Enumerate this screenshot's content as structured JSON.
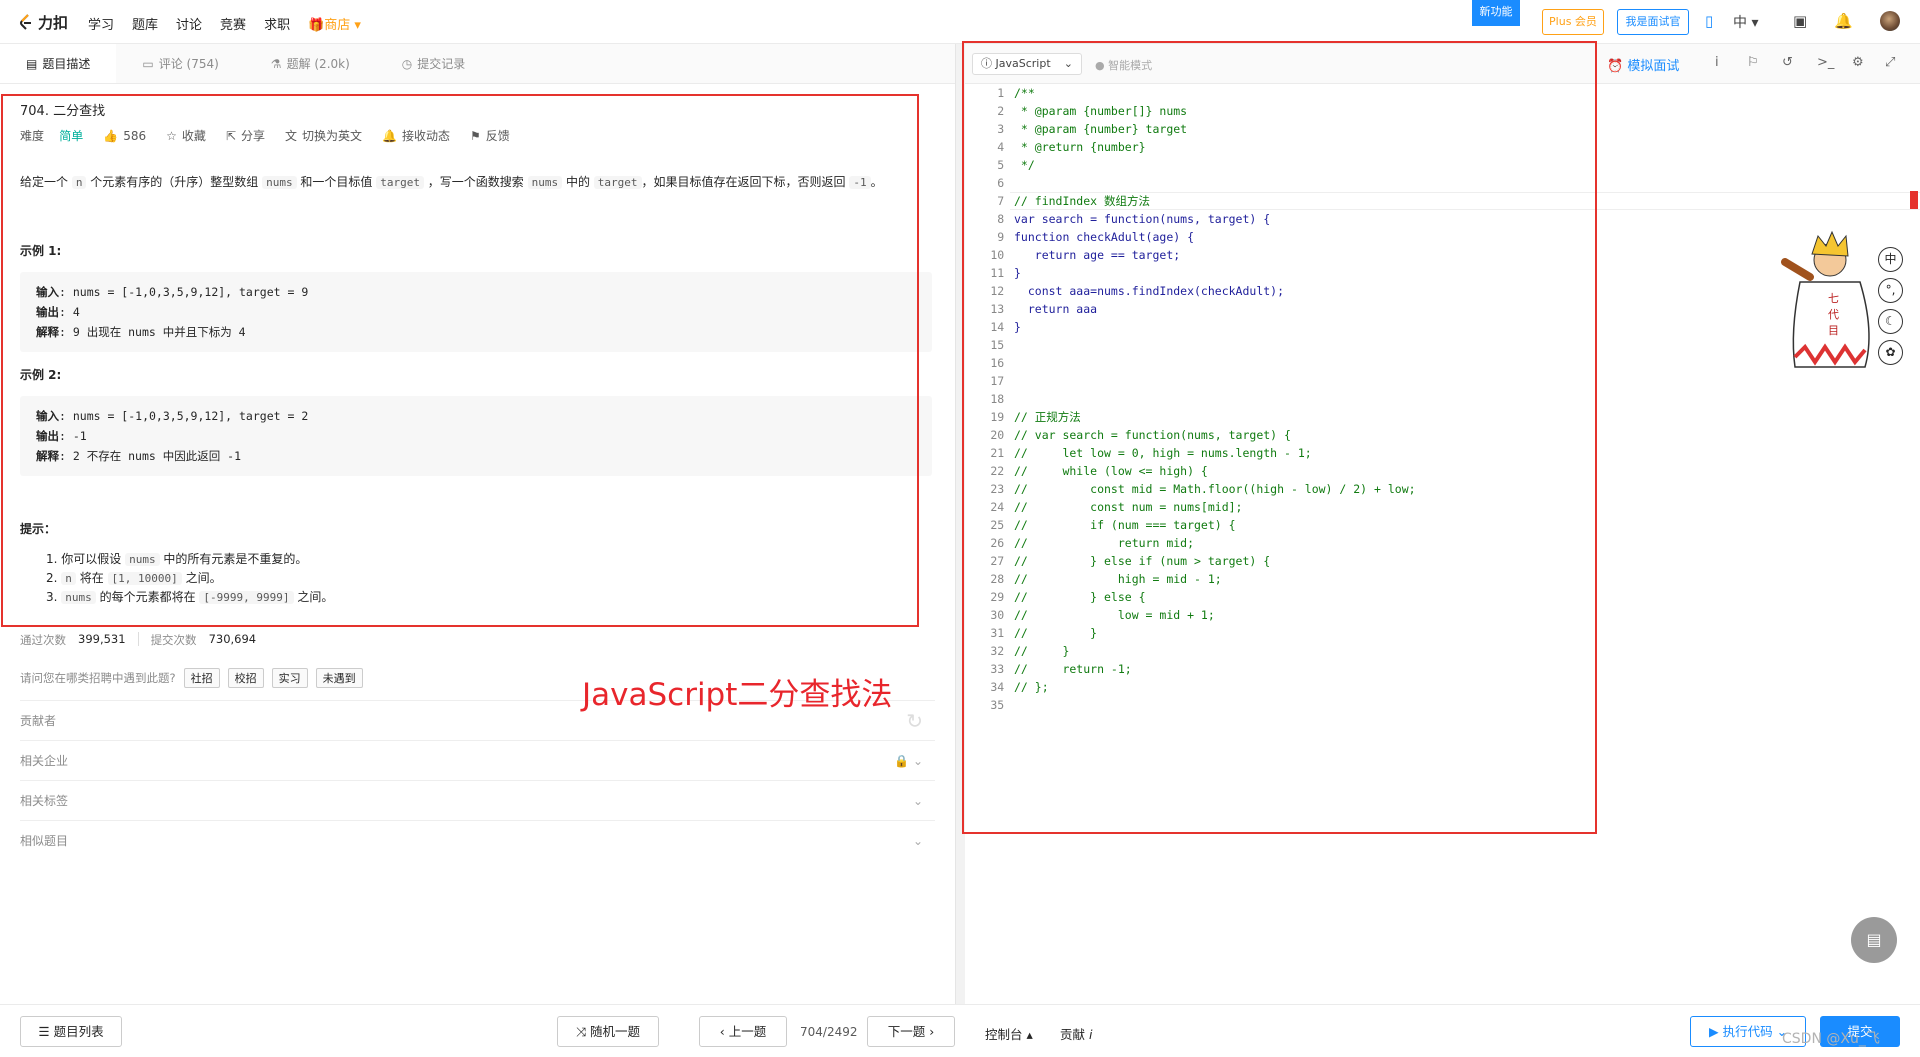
{
  "topbar": {
    "logo": "力扣",
    "nav": [
      "学习",
      "题库",
      "讨论",
      "竞赛",
      "求职"
    ],
    "shop": "商店",
    "new_feature": "新功能",
    "plus": "Plus 会员",
    "interviewer": "我是面试官",
    "lang": "中"
  },
  "left_tabs": [
    {
      "label": "题目描述",
      "icon": "book-icon"
    },
    {
      "label": "评论 (754)",
      "icon": "comment-icon"
    },
    {
      "label": "题解 (2.0k)",
      "icon": "flask-icon"
    },
    {
      "label": "提交记录",
      "icon": "clock-icon"
    }
  ],
  "problem": {
    "title": "704. 二分查找",
    "difficulty_label": "难度",
    "difficulty": "简单",
    "likes": "586",
    "favorite": "收藏",
    "share": "分享",
    "translate": "切换为英文",
    "subscribe": "接收动态",
    "feedback": "反馈",
    "desc_parts": [
      "给定一个 ",
      "n",
      " 个元素有序的（升序）整型数组 ",
      "nums",
      " 和一个目标值 ",
      "target",
      " ，写一个函数搜索 ",
      "nums",
      " 中的 ",
      "target",
      "，如果目标值存在返回下标，否则返回 ",
      "-1",
      "。"
    ],
    "example1_title": "示例 1:",
    "example1": {
      "input_label": "输入",
      "input": ": nums = [-1,0,3,5,9,12], target = 9",
      "output_label": "输出",
      "output": ": 4",
      "explain_label": "解释",
      "explain": ": 9 出现在 nums 中并且下标为 4"
    },
    "example2_title": "示例 2:",
    "example2": {
      "input_label": "输入",
      "input": ": nums = [-1,0,3,5,9,12], target = 2",
      "output_label": "输出",
      "output": ": -1",
      "explain_label": "解释",
      "explain": ": 2 不存在 nums 中因此返回 -1"
    },
    "hint_title": "提示：",
    "hints": [
      [
        "1. 你可以假设 ",
        "nums",
        " 中的所有元素是不重复的。"
      ],
      [
        "2. ",
        "n",
        " 将在 ",
        "[1, 10000]",
        " 之间。"
      ],
      [
        "3. ",
        "nums",
        " 的每个元素都将在 ",
        "[-9999, 9999]",
        " 之间。"
      ]
    ],
    "accepted_label": "通过次数",
    "accepted": "399,531",
    "submitted_label": "提交次数",
    "submitted": "730,694",
    "recruit_q": "请问您在哪类招聘中遇到此题?",
    "recruit_chips": [
      "社招",
      "校招",
      "实习",
      "未遇到"
    ],
    "sections": [
      "贡献者",
      "相关企业",
      "相关标签",
      "相似题目"
    ]
  },
  "annotation": "JavaScript二分查找法",
  "editor": {
    "language": "JavaScript",
    "smart_mode": "智能模式",
    "mock_interview": "模拟面试",
    "line_count": 35,
    "code": [
      "/**",
      " * @param {number[]} nums",
      " * @param {number} target",
      " * @return {number}",
      " */",
      "",
      "// findIndex 数组方法",
      "var search = function(nums, target) {",
      "function checkAdult(age) {",
      "   return age == target;",
      "}",
      "  const aaa=nums.findIndex(checkAdult);",
      "  return aaa",
      "}",
      "",
      "",
      "",
      "",
      "// 正规方法",
      "// var search = function(nums, target) {",
      "//     let low = 0, high = nums.length - 1;",
      "//     while (low <= high) {",
      "//         const mid = Math.floor((high - low) / 2) + low;",
      "//         const num = nums[mid];",
      "//         if (num === target) {",
      "//             return mid;",
      "//         } else if (num > target) {",
      "//             high = mid - 1;",
      "//         } else {",
      "//             low = mid + 1;",
      "//         }",
      "//     }",
      "//     return -1;",
      "// };",
      ""
    ],
    "mascot_side": [
      "中",
      "°,",
      "☾",
      "✿"
    ]
  },
  "bottom": {
    "problem_list": "题目列表",
    "random": "随机一题",
    "prev": "上一题",
    "page": "704/2492",
    "next": "下一题",
    "console": "控制台",
    "contribute": "贡献",
    "run": "执行代码",
    "submit": "提交"
  },
  "watermark": "CSDN @Xu_飞",
  "colors": {
    "accent": "#1a8cff",
    "easy": "#00af9b",
    "shop": "#ffa116",
    "annotation": "#e8262c"
  }
}
